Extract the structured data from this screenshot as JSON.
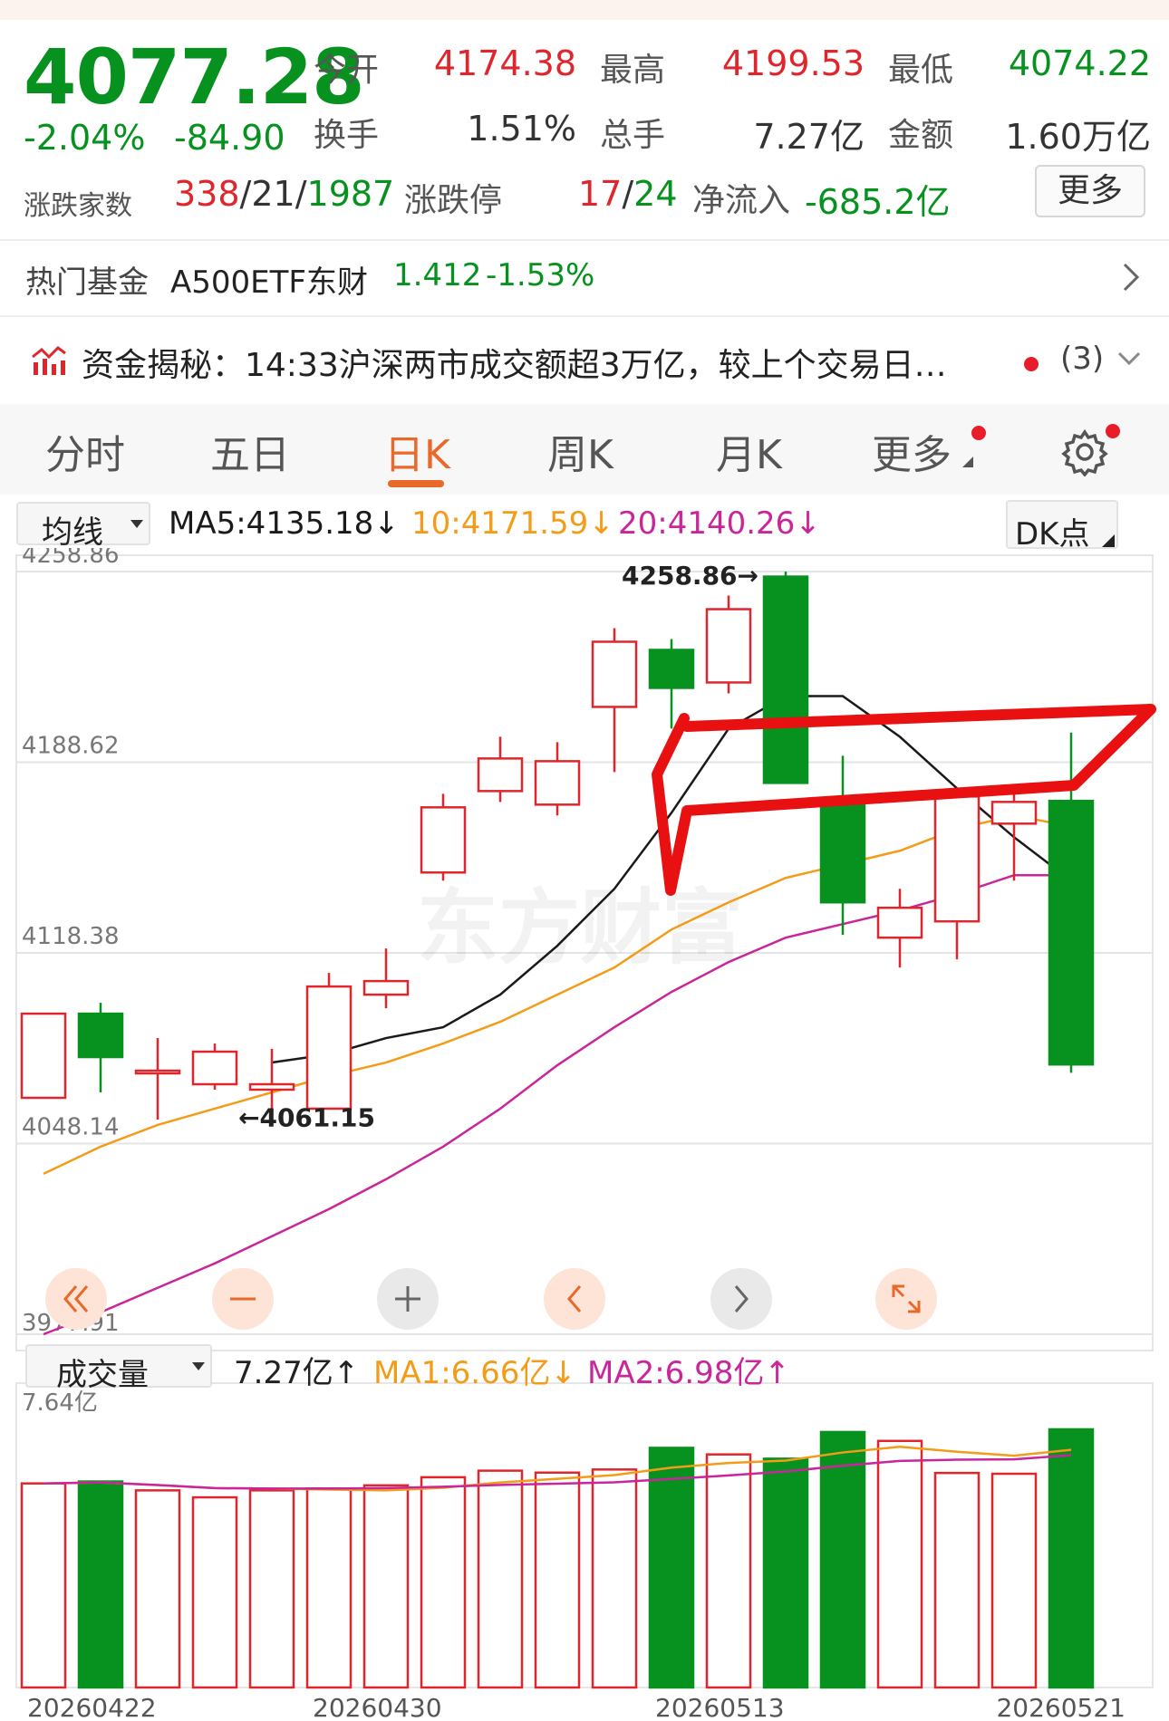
{
  "quote": {
    "price": "4077.28",
    "change_pct": "-2.04%",
    "change_abs": "-84.90",
    "open_label": "今开",
    "open": "4174.38",
    "high_label": "最高",
    "high": "4199.53",
    "low_label": "最低",
    "low": "4074.22",
    "turnover_label": "换手",
    "turnover": "1.51%",
    "volume_label": "总手",
    "volume": "7.27亿",
    "amount_label": "金额",
    "amount": "1.60万亿",
    "breadth_label": "涨跌家数",
    "breadth_up": "338",
    "breadth_flat": "21",
    "breadth_down": "1987",
    "limit_label": "涨跌停",
    "limit_up": "17",
    "limit_down": "24",
    "netflow_label": "净流入",
    "netflow": "-685.2亿",
    "more_button": "更多"
  },
  "fund": {
    "label": "热门基金",
    "name": "A500ETF东财",
    "price": "1.412",
    "change": "-1.53%"
  },
  "news": {
    "icon": "chart-icon",
    "text": "资金揭秘：14:33沪深两市成交额超3万亿，较上个交易日…",
    "count": "(3)"
  },
  "tabs": [
    {
      "label": "分时"
    },
    {
      "label": "五日"
    },
    {
      "label": "日K"
    },
    {
      "label": "周K"
    },
    {
      "label": "月K"
    },
    {
      "label": "更多"
    }
  ],
  "active_tab": "日K",
  "ma_bar": {
    "selector": "均线",
    "ma5": "MA5:4135.18↓",
    "ma10": "10:4171.59↓",
    "ma20": "20:4140.26↓",
    "dk_button": "DK点"
  },
  "vol_bar": {
    "selector": "成交量",
    "vol": "7.27亿↑",
    "ma1": "MA1:6.66亿↓",
    "ma2": "MA2:6.98亿↑"
  },
  "colors": {
    "up": "#e0262d",
    "down": "#07921f",
    "ma5": "#1a1a1a",
    "ma10": "#f39c19",
    "ma20": "#c8269a",
    "accent": "#e8692a"
  },
  "chart_data": {
    "type": "candlestick",
    "y_ticks": [
      "4258.86",
      "4188.62",
      "4118.38",
      "4048.14",
      "3977.91"
    ],
    "ylim": [
      3977.91,
      4258.86
    ],
    "x_tick_labels": [
      "20260422",
      "20260430",
      "20260513",
      "20260521"
    ],
    "annotations": [
      "4258.86→",
      "←4061.15"
    ],
    "watermark": "东方财富",
    "candles": [
      {
        "open": 4065,
        "close": 4096,
        "high": 4096,
        "low": 4065
      },
      {
        "open": 4096,
        "close": 4080,
        "high": 4100,
        "low": 4067
      },
      {
        "open": 4075,
        "close": 4075,
        "high": 4087,
        "low": 4057
      },
      {
        "open": 4070,
        "close": 4082,
        "high": 4085,
        "low": 4068
      },
      {
        "open": 4068,
        "close": 4070,
        "high": 4083,
        "low": 4060
      },
      {
        "open": 4061,
        "close": 4106,
        "high": 4111,
        "low": 4061
      },
      {
        "open": 4103,
        "close": 4108,
        "high": 4120,
        "low": 4098
      },
      {
        "open": 4148,
        "close": 4172,
        "high": 4177,
        "low": 4145
      },
      {
        "open": 4178,
        "close": 4190,
        "high": 4198,
        "low": 4174
      },
      {
        "open": 4173,
        "close": 4189,
        "high": 4196,
        "low": 4169
      },
      {
        "open": 4209,
        "close": 4233,
        "high": 4238,
        "low": 4185
      },
      {
        "open": 4230,
        "close": 4216,
        "high": 4234,
        "low": 4201
      },
      {
        "open": 4218,
        "close": 4245,
        "high": 4250,
        "low": 4214
      },
      {
        "open": 4257,
        "close": 4181,
        "high": 4258.86,
        "low": 4181
      },
      {
        "open": 4174,
        "close": 4137,
        "high": 4191,
        "low": 4125
      },
      {
        "open": 4124,
        "close": 4135,
        "high": 4142,
        "low": 4113
      },
      {
        "open": 4130,
        "close": 4176,
        "high": 4179,
        "low": 4116
      },
      {
        "open": 4166,
        "close": 4174,
        "high": 4178,
        "low": 4145
      },
      {
        "open": 4174.38,
        "close": 4077.28,
        "high": 4199.53,
        "low": 4074.22
      }
    ],
    "ma5": [
      null,
      null,
      null,
      null,
      4078,
      4081,
      4087,
      4091,
      4103,
      4121,
      4142,
      4170,
      4201,
      4213,
      4213,
      4198,
      4179,
      4161,
      4145
    ],
    "ma10": [
      4037,
      4047,
      4055,
      4061,
      4067,
      4073,
      4078,
      4085,
      4093,
      4103,
      4113,
      4127,
      4137,
      4146,
      4151,
      4156,
      4164,
      4169,
      4165
    ],
    "ma20": [
      3977.91,
      3986,
      3995,
      4004,
      4014,
      4024,
      4035,
      4047,
      4061,
      4077,
      4091,
      4104,
      4115,
      4124,
      4129,
      4134,
      4140,
      4147,
      4147
    ],
    "volume_ylim": [
      0,
      7.64
    ],
    "volume_ytick": "7.64亿",
    "volume": [
      5.28,
      5.33,
      5.1,
      4.92,
      5.1,
      5.15,
      5.23,
      5.44,
      5.61,
      5.56,
      5.64,
      6.2,
      6.03,
      5.92,
      6.61,
      6.38,
      5.55,
      5.53,
      6.68
    ]
  }
}
